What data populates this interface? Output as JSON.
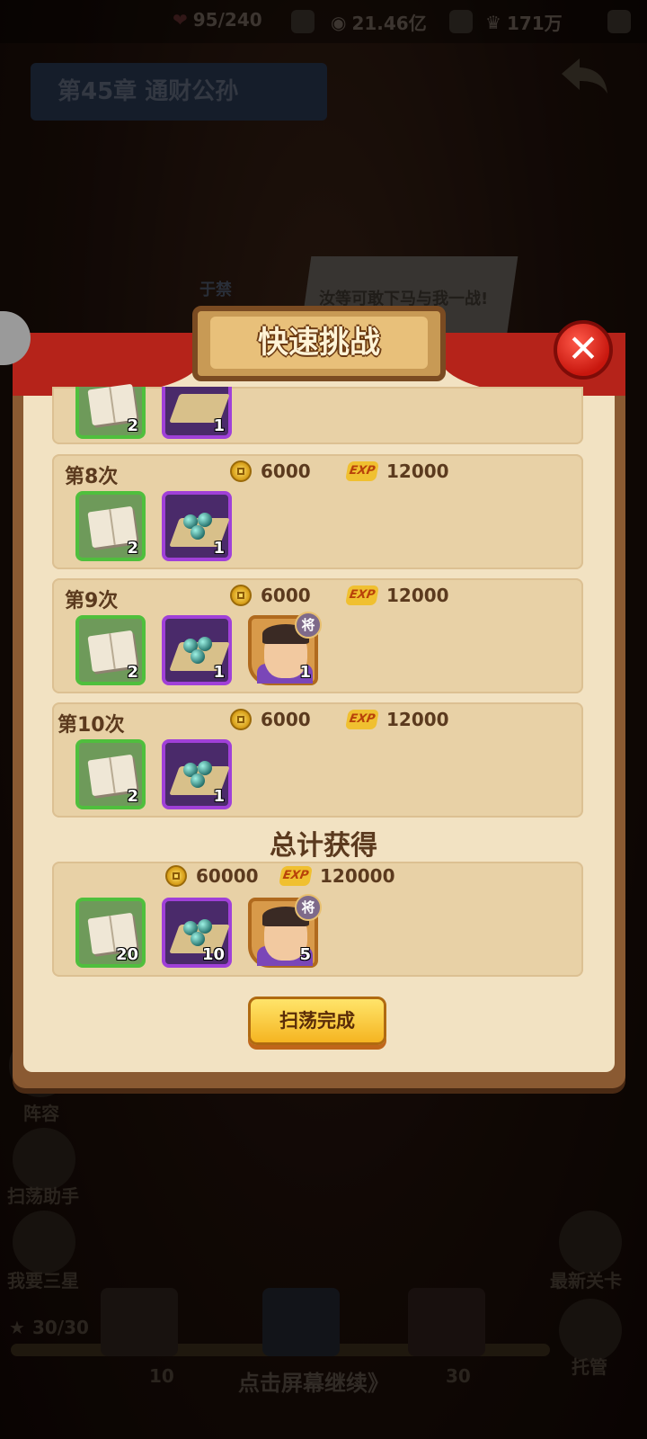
{
  "topbar": {
    "stamina": "95/240",
    "gold": "21.46亿",
    "gems": "171万"
  },
  "background": {
    "chapter_title": "第45章  通财公孙",
    "npc_name": "于禁",
    "speech": "汝等可敢下马与我一战!",
    "left_labels": [
      "阵容",
      "扫荡助手",
      "我要三星"
    ],
    "right_labels": [
      "最新关卡",
      "托管"
    ],
    "star_progress": "30/30",
    "chest_counts": [
      "10",
      "30"
    ],
    "bottom_hint": "点击屏幕继续》"
  },
  "dialog": {
    "title": "快速挑战",
    "rounds": [
      {
        "label": "第8次",
        "gold": "6000",
        "exp": "12000",
        "items": [
          {
            "kind": "book",
            "qty": "2"
          },
          {
            "kind": "pearl",
            "qty": "1"
          }
        ]
      },
      {
        "label": "第9次",
        "gold": "6000",
        "exp": "12000",
        "items": [
          {
            "kind": "book",
            "qty": "2"
          },
          {
            "kind": "pearl",
            "qty": "1"
          },
          {
            "kind": "hero",
            "qty": "1",
            "badge": "将"
          }
        ]
      },
      {
        "label": "第10次",
        "gold": "6000",
        "exp": "12000",
        "items": [
          {
            "kind": "book",
            "qty": "2"
          },
          {
            "kind": "pearl",
            "qty": "1"
          }
        ]
      }
    ],
    "partial_round_items": [
      {
        "kind": "book",
        "qty": "2"
      },
      {
        "kind": "pearl",
        "qty": "1"
      }
    ],
    "total": {
      "title": "总计获得",
      "gold": "60000",
      "exp": "120000",
      "items": [
        {
          "kind": "book",
          "qty": "20"
        },
        {
          "kind": "pearl",
          "qty": "10"
        },
        {
          "kind": "hero",
          "qty": "5",
          "badge": "将"
        }
      ]
    },
    "exp_icon_text": "EXP",
    "done_button": "扫荡完成",
    "close_glyph": "✕"
  },
  "colors": {
    "panel_bg": "#f2e2c2",
    "card_bg": "#e8d1a6",
    "text_brown": "#5b3a1e",
    "close_red": "#c8170e",
    "button_yellow": "#f5b521"
  }
}
